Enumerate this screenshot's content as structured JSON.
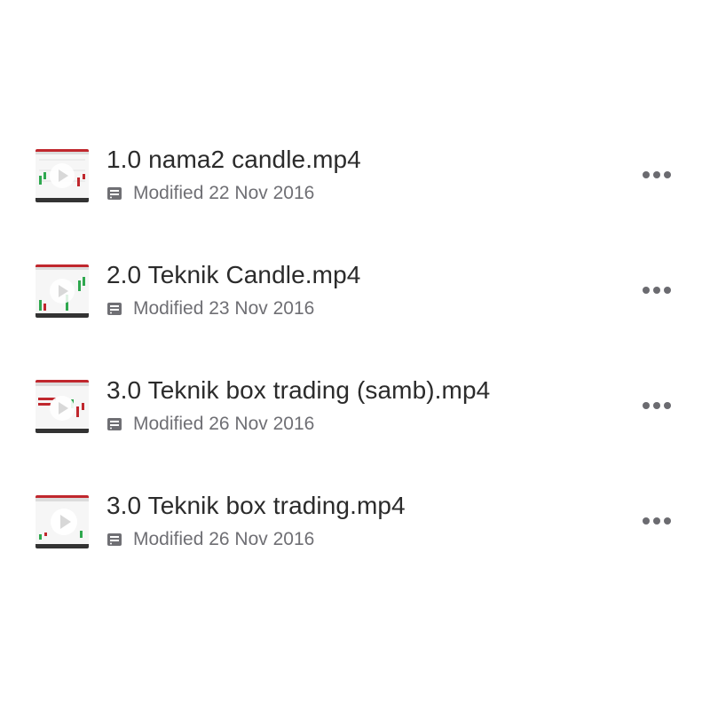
{
  "files": [
    {
      "name": "1.0 nama2 candle.mp4",
      "modified": "Modified 22 Nov 2016",
      "meta_icon": "drive-icon",
      "more_icon": "more-horizontal-icon"
    },
    {
      "name": "2.0 Teknik Candle.mp4",
      "modified": "Modified 23 Nov 2016",
      "meta_icon": "drive-icon",
      "more_icon": "more-horizontal-icon"
    },
    {
      "name": "3.0 Teknik box trading (samb).mp4",
      "modified": "Modified 26 Nov 2016",
      "meta_icon": "drive-icon",
      "more_icon": "more-horizontal-icon"
    },
    {
      "name": "3.0 Teknik box trading.mp4",
      "modified": "Modified 26 Nov 2016",
      "meta_icon": "drive-icon",
      "more_icon": "more-horizontal-icon"
    }
  ],
  "colors": {
    "title": "#2b2b2b",
    "meta": "#6f6f74",
    "dots": "#6b6b70",
    "thumb_red": "#c0272d",
    "thumb_green": "#2fa84f"
  }
}
